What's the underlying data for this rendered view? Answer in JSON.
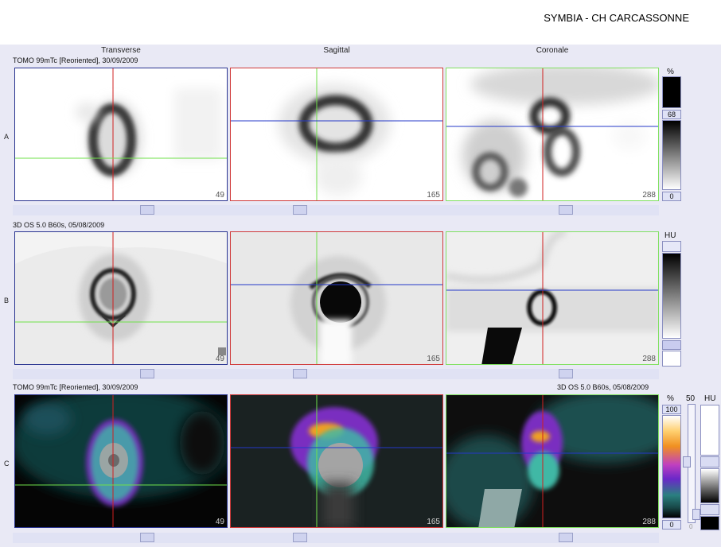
{
  "title": "SYMBIA - CH CARCASSONNE",
  "columns": [
    "Transverse",
    "Sagittal",
    "Coronale"
  ],
  "rows": {
    "A": {
      "letter": "A",
      "info": "TOMO 99mTc [Reoriented], 30/09/2009"
    },
    "B": {
      "letter": "B",
      "info": "3D  OS  5.0  B60s, 05/08/2009"
    },
    "C": {
      "letter": "C",
      "info_left": "TOMO 99mTc [Reoriented], 30/09/2009",
      "info_right": "3D  OS  5.0  B60s, 05/08/2009"
    }
  },
  "slice_numbers": [
    "49",
    "165",
    "288"
  ],
  "colorbars": {
    "A": {
      "unit": "%",
      "value_top": "68",
      "value_bottom": "0"
    },
    "B": {
      "unit": "HU"
    },
    "C": {
      "unit_left": "%",
      "value_top": "100",
      "value_bottom": "0",
      "window_value": "50",
      "window_zero": "0",
      "unit_right": "HU"
    }
  },
  "crosshair_colors": {
    "red": "#d02020",
    "green": "#6fe04a",
    "blue": "#2438c8"
  },
  "view_borders": {
    "transverse": "#2a3490",
    "sagittal": "#d03a3a",
    "coronal": "#80e060"
  }
}
